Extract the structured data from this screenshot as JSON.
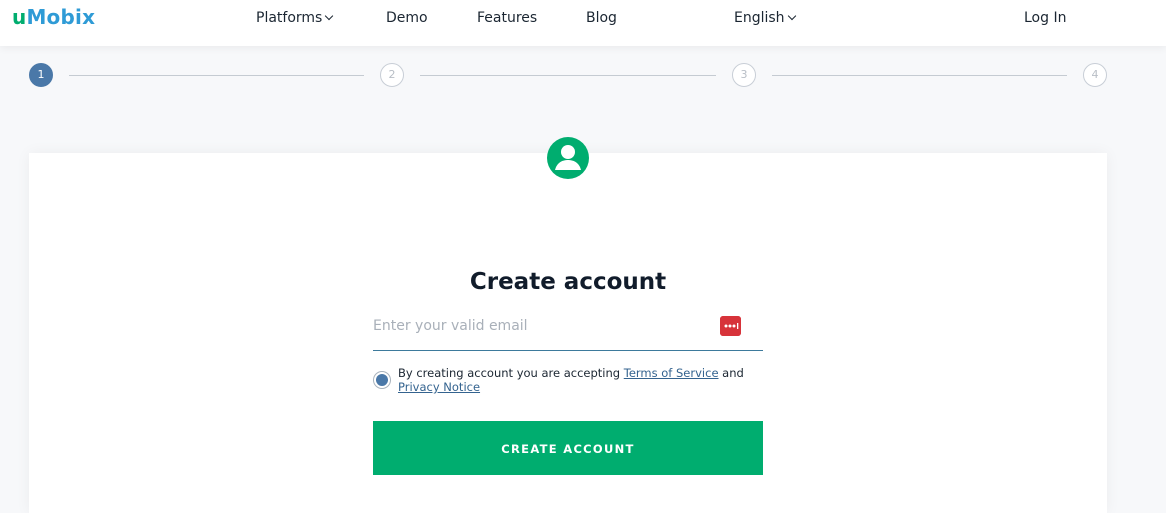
{
  "header": {
    "logo_u": "u",
    "logo_rest": "Mobix",
    "nav": {
      "platforms": "Platforms",
      "demo": "Demo",
      "features": "Features",
      "blog": "Blog",
      "language": "English",
      "login": "Log In"
    }
  },
  "stepper": {
    "steps": [
      "1",
      "2",
      "3",
      "4"
    ],
    "active_step": 1
  },
  "form": {
    "title": "Create account",
    "email_placeholder": "Enter your valid email",
    "email_value": "",
    "consent_prefix": "By creating account you are accepting",
    "terms_link": "Terms of Service",
    "consent_and": "and",
    "privacy_link": "Privacy Notice",
    "consent_checked": true,
    "submit_label": "CREATE ACCOUNT"
  },
  "colors": {
    "brand_green": "#00ad6f",
    "brand_blue": "#2f9bd6",
    "step_active": "#4a78a8",
    "password_manager_icon": "#d7333a"
  },
  "icons": {
    "avatar": "user-circle-icon",
    "password_manager": "password-manager-icon",
    "dropdown": "chevron-down-icon"
  }
}
